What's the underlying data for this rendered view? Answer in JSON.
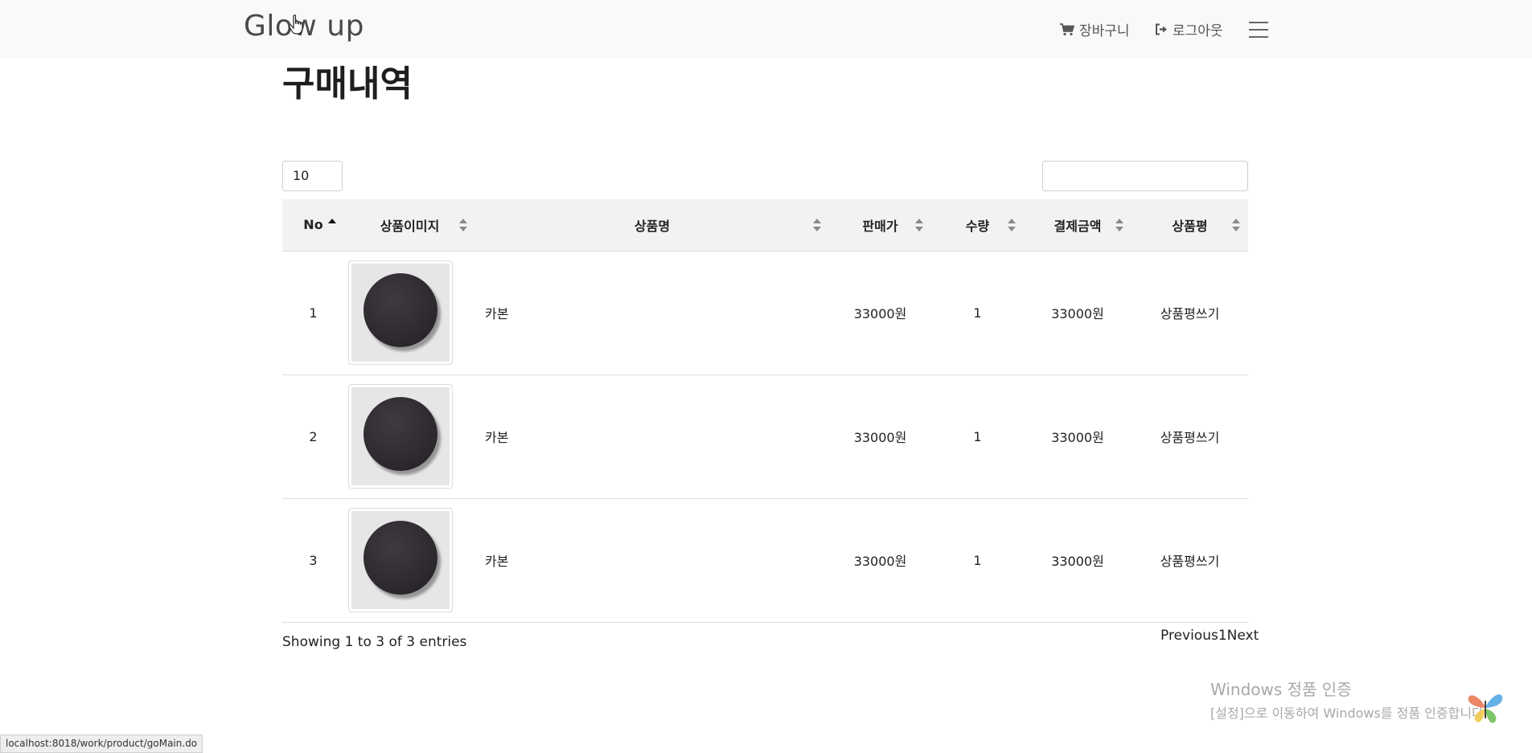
{
  "navbar": {
    "brand": "Glow up",
    "cart_label": "장바구니",
    "logout_label": "로그아웃"
  },
  "page": {
    "title": "구매내역"
  },
  "controls": {
    "length_value": "10",
    "search_value": ""
  },
  "table": {
    "columns": [
      "No",
      "상품이미지",
      "상품명",
      "판매가",
      "수량",
      "결제금액",
      "상품평"
    ],
    "rows": [
      {
        "no": "1",
        "name": "카본",
        "price": "33000원",
        "qty": "1",
        "total": "33000원",
        "review": "상품평쓰기"
      },
      {
        "no": "2",
        "name": "카본",
        "price": "33000원",
        "qty": "1",
        "total": "33000원",
        "review": "상품평쓰기"
      },
      {
        "no": "3",
        "name": "카본",
        "price": "33000원",
        "qty": "1",
        "total": "33000원",
        "review": "상품평쓰기"
      }
    ]
  },
  "footer": {
    "info": "Showing 1 to 3 of 3 entries",
    "previous": "Previous",
    "page": "1",
    "next": "Next"
  },
  "watermark": {
    "line1": "Windows 정품 인증",
    "line2": "[설정]으로 이동하여 Windows를 정품 인증합니다."
  },
  "statusbar": {
    "url": "localhost:8018/work/product/goMain.do"
  }
}
